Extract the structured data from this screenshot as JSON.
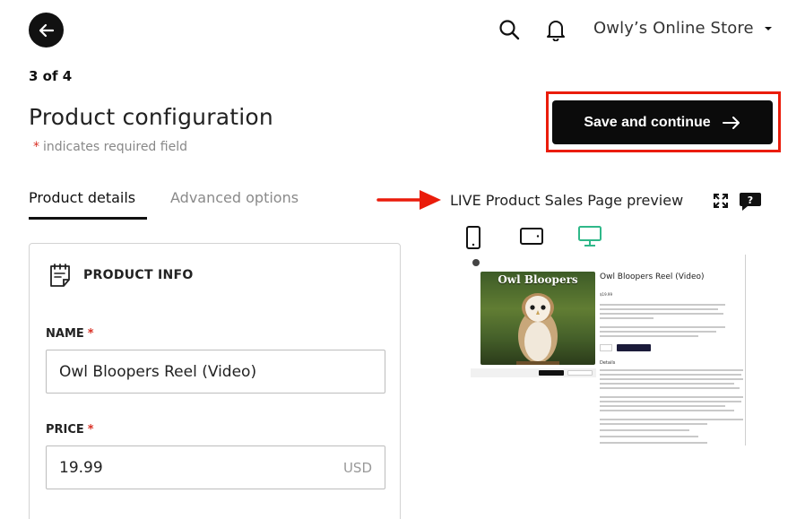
{
  "header": {
    "back_icon": "arrow-left-icon",
    "search_icon": "search-icon",
    "bell_icon": "bell-icon",
    "store_name": "Owly’s Online Store",
    "store_chevron": "chevron-down-icon"
  },
  "step": "3 of 4",
  "title": "Product configuration",
  "required_note": {
    "star": "*",
    "text": "indicates required field"
  },
  "save_button": {
    "label": "Save and continue",
    "icon": "arrow-right-icon"
  },
  "tabs": [
    {
      "label": "Product details",
      "active": true
    },
    {
      "label": "Advanced options",
      "active": false
    }
  ],
  "preview": {
    "title": "LIVE Product Sales Page preview",
    "expand_icon": "expand-icon",
    "help_icon": "help-bubble-icon",
    "devices": [
      {
        "name": "mobile",
        "icon": "phone-icon",
        "selected": false
      },
      {
        "name": "tablet",
        "icon": "tablet-icon",
        "selected": false
      },
      {
        "name": "desktop",
        "icon": "desktop-icon",
        "selected": true
      }
    ],
    "page": {
      "image_title": "Owl Bloopers",
      "product_title": "Owl Bloopers Reel (Video)",
      "price": "$19.99",
      "details_heading": "Details"
    }
  },
  "product_info": {
    "heading": "PRODUCT INFO",
    "icon": "sticky-note-icon",
    "name_label": "NAME",
    "name_value": "Owl Bloopers Reel (Video)",
    "price_label": "PRICE",
    "price_value": "19.99",
    "price_currency": "USD",
    "required_star": "*"
  },
  "colors": {
    "accent_dark": "#0b0b0b",
    "highlight_red": "#ea1c0b",
    "required_red": "#d93025",
    "desktop_selected": "#2fb889"
  }
}
